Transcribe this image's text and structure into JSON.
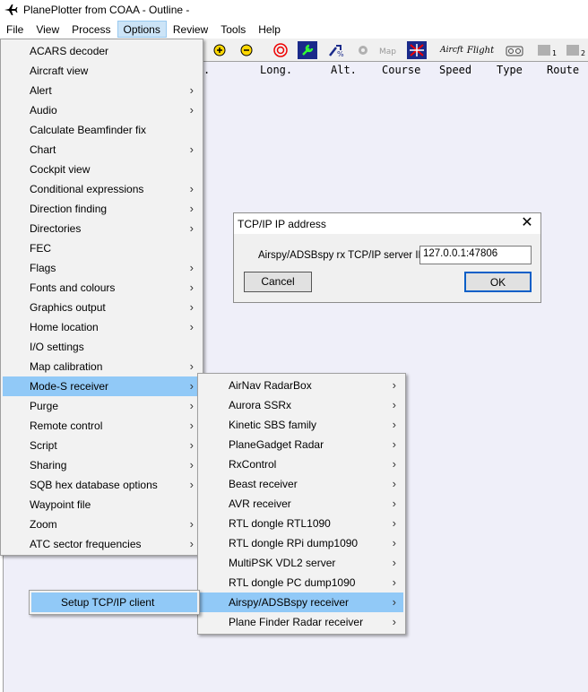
{
  "window": {
    "title": "PlanePlotter from COAA - Outline -"
  },
  "menubar": [
    "File",
    "View",
    "Process",
    "Options",
    "Review",
    "Tools",
    "Help"
  ],
  "toolbar": {
    "aircraft_label": "Aircft",
    "flight_label": "Flight",
    "map_label": "Map",
    "slot1": "1",
    "slot2": "2"
  },
  "columns": [
    ".",
    "Long.",
    "Alt.",
    "Course",
    "Speed",
    "Type",
    "Route"
  ],
  "options_menu": [
    {
      "label": "ACARS decoder",
      "sub": false
    },
    {
      "label": "Aircraft view",
      "sub": false
    },
    {
      "label": "Alert",
      "sub": true
    },
    {
      "label": "Audio",
      "sub": true
    },
    {
      "label": "Calculate Beamfinder fix",
      "sub": false
    },
    {
      "label": "Chart",
      "sub": true
    },
    {
      "label": "Cockpit view",
      "sub": false
    },
    {
      "label": "Conditional expressions",
      "sub": true
    },
    {
      "label": "Direction finding",
      "sub": true
    },
    {
      "label": "Directories",
      "sub": true
    },
    {
      "label": "FEC",
      "sub": false
    },
    {
      "label": "Flags",
      "sub": true
    },
    {
      "label": "Fonts and colours",
      "sub": true
    },
    {
      "label": "Graphics output",
      "sub": true
    },
    {
      "label": "Home location",
      "sub": true
    },
    {
      "label": "I/O settings",
      "sub": false
    },
    {
      "label": "Map calibration",
      "sub": true
    },
    {
      "label": "Mode-S receiver",
      "sub": true
    },
    {
      "label": "Purge",
      "sub": true
    },
    {
      "label": "Remote control",
      "sub": true
    },
    {
      "label": "Script",
      "sub": true
    },
    {
      "label": "Sharing",
      "sub": true
    },
    {
      "label": "SQB hex database options",
      "sub": true
    },
    {
      "label": "Waypoint file",
      "sub": false
    },
    {
      "label": "Zoom",
      "sub": true
    },
    {
      "label": "ATC sector frequencies",
      "sub": true
    }
  ],
  "modes_menu": [
    "AirNav RadarBox",
    "Aurora SSRx",
    "Kinetic SBS family",
    "PlaneGadget Radar",
    "RxControl",
    "Beast receiver",
    "AVR receiver",
    "RTL dongle RTL1090",
    "RTL dongle RPi dump1090",
    "MultiPSK VDL2 server",
    "RTL dongle PC dump1090",
    "Airspy/ADSBspy receiver",
    "Plane Finder Radar receiver"
  ],
  "airspy_menu": {
    "item": "Setup TCP/IP client"
  },
  "dialog": {
    "title": "TCP/IP IP address",
    "close": "✕",
    "label": "Airspy/ADSBspy rx TCP/IP server IP",
    "value": "127.0.0.1:47806",
    "cancel": "Cancel",
    "ok": "OK"
  },
  "arrow_glyph": "›"
}
